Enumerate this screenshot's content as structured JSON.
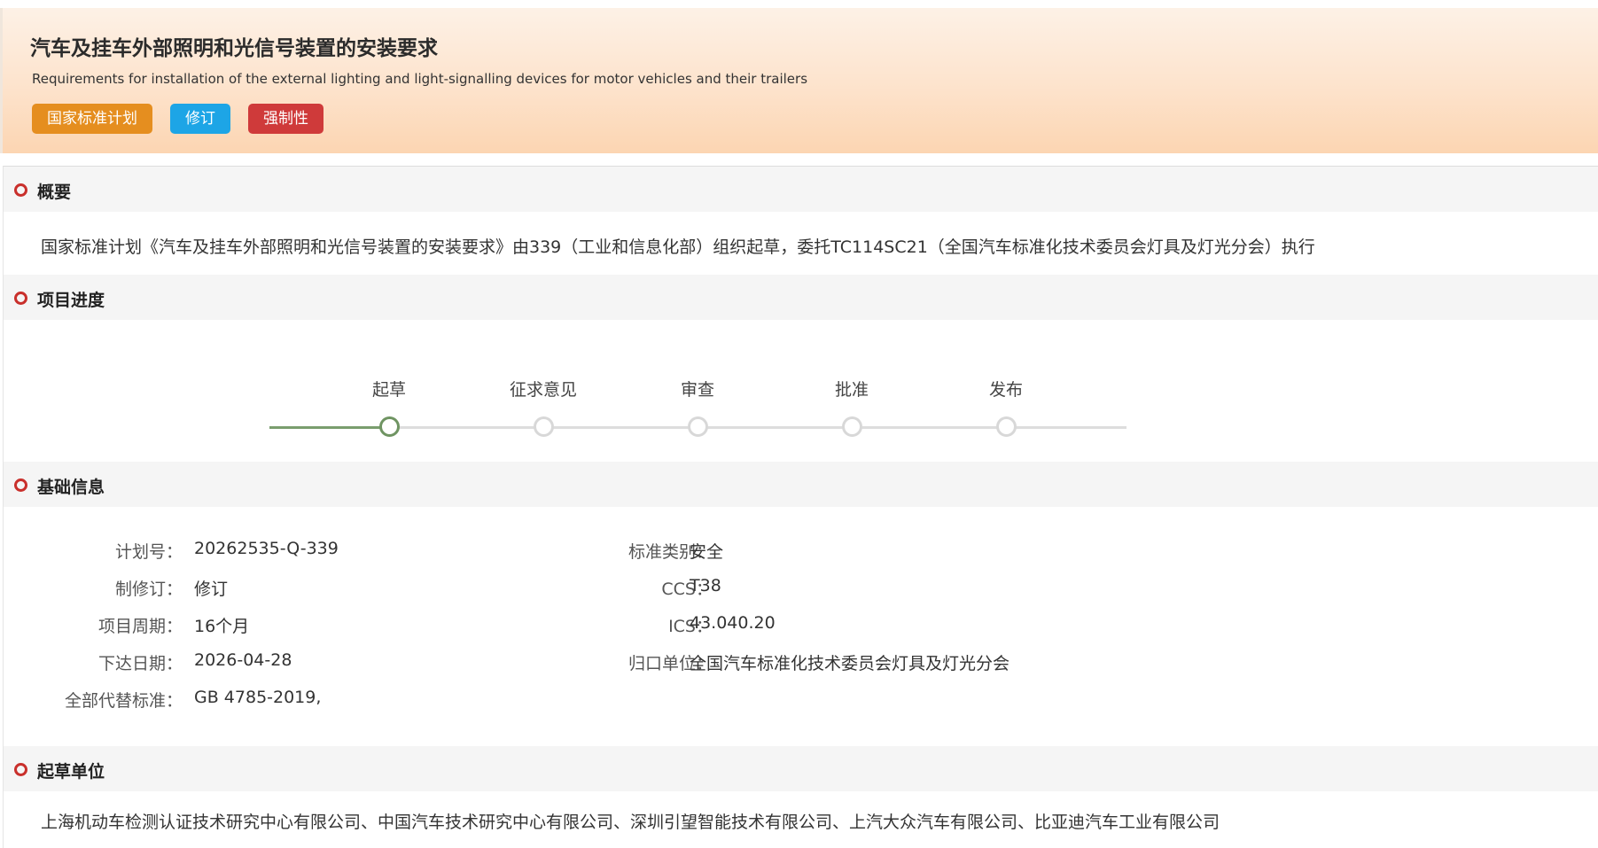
{
  "header": {
    "title": "汽车及挂车外部照明和光信号装置的安装要求",
    "subtitle": "Requirements for installation of the external lighting and light-signalling devices for motor vehicles and their trailers",
    "tags": [
      {
        "label": "国家标准计划",
        "color": "#e58e1f"
      },
      {
        "label": "修订",
        "color": "#1da5e6"
      },
      {
        "label": "强制性",
        "color": "#cf3a3a"
      }
    ]
  },
  "sections": {
    "overview": {
      "title": "概要",
      "text": "国家标准计划《汽车及挂车外部照明和光信号装置的安装要求》由339（工业和信息化部）组织起草，委托TC114SC21（全国汽车标准化技术委员会灯具及灯光分会）执行"
    },
    "progress": {
      "title": "项目进度",
      "steps": [
        "起草",
        "征求意见",
        "审查",
        "批准",
        "发布"
      ],
      "current_step_index": 0
    },
    "basic_info": {
      "title": "基础信息",
      "left": [
        {
          "key": "计划号：",
          "value": "20262535-Q-339"
        },
        {
          "key": "制修订：",
          "value": "修订"
        },
        {
          "key": "项目周期：",
          "value": "16个月"
        },
        {
          "key": "下达日期：",
          "value": "2026-04-28"
        },
        {
          "key": "全部代替标准：",
          "value": "GB 4785-2019,"
        }
      ],
      "right": [
        {
          "key": "标准类别：",
          "value": "安全"
        },
        {
          "key": "CCS：",
          "value": "T38"
        },
        {
          "key": "ICS：",
          "value": "43.040.20"
        },
        {
          "key": "归口单位：",
          "value": "全国汽车标准化技术委员会灯具及灯光分会"
        }
      ]
    },
    "drafting_units": {
      "title": "起草单位",
      "text": "上海机动车检测认证技术研究中心有限公司、中国汽车技术研究中心有限公司、深圳引望智能技术有限公司、上汽大众汽车有限公司、比亚迪汽车工业有限公司"
    }
  },
  "colors": {
    "accent_ring": "#c9302c",
    "progress_done": "#6f9462",
    "progress_pending": "#d8d8d8"
  }
}
